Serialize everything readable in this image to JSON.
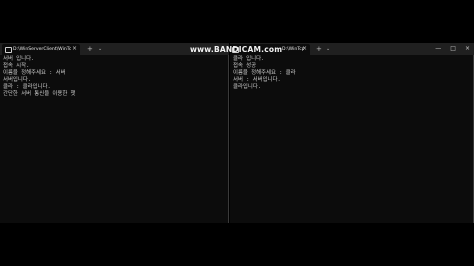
{
  "left_window": {
    "tab_title": "D:\\WinServerClient\\WinTcpWebr",
    "tab_close": "×",
    "new_tab": "+",
    "dropdown": "⌄",
    "console_lines": [
      "서버 입니다.",
      "접속 시작.",
      "이름을 정해주세요 : 서버",
      "서버입니다.",
      "클라 : 클라입니다.",
      "간단한 서버 통신을 이용한 챗"
    ]
  },
  "right_window": {
    "tab_title": "D:\\WinTcpWebr",
    "tab_close": "×",
    "new_tab": "+",
    "dropdown": "⌄",
    "controls": {
      "minimize": "—",
      "maximize": "□",
      "close": "×"
    },
    "console_lines": [
      "클라 입니다.",
      "접속 성공",
      "이름을 정해주세요 : 클라",
      "서버 : 서버입니다.",
      "클라입니다."
    ]
  },
  "watermark": {
    "text": "www.BANDICAM.com"
  }
}
